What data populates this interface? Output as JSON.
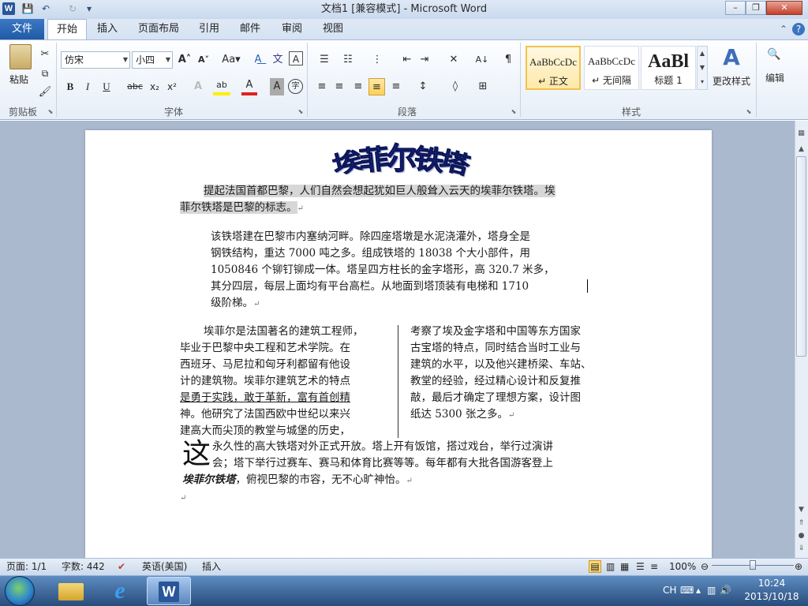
{
  "window": {
    "title": "文档1 [兼容模式] - Microsoft Word",
    "app_icon": "W",
    "minimize": "–",
    "restore": "❐",
    "close": "✕"
  },
  "qat": {
    "save_icon": "💾",
    "undo_icon": "↶",
    "redo_icon": "↻",
    "customize_icon": "▾"
  },
  "tabs": {
    "file": "文件",
    "home": "开始",
    "insert": "插入",
    "layout": "页面布局",
    "references": "引用",
    "mailings": "邮件",
    "review": "审阅",
    "view": "视图"
  },
  "ribbon": {
    "clipboard": {
      "label": "剪贴板",
      "paste": "粘贴"
    },
    "font": {
      "label": "字体",
      "font_name": "仿宋",
      "font_size": "小四",
      "grow": "A˄",
      "shrink": "A˅",
      "case": "Aa▾",
      "bold": "B",
      "italic": "I",
      "underline": "U",
      "strike": "abc",
      "sub": "x₂",
      "sup": "x²",
      "text_effect": "A",
      "highlight": "ab",
      "font_color": "A",
      "char_shade": "A",
      "enclose": "字"
    },
    "paragraph": {
      "label": "段落",
      "bullets": "☰",
      "numbering": "☷",
      "multilevel": "⋮",
      "decrease_indent": "⇤",
      "increase_indent": "⇥",
      "chinese_layout": "✕",
      "sort": "A↓",
      "show_marks": "¶",
      "align_left": "≡",
      "center": "≡",
      "align_right": "≡",
      "justify": "≡",
      "distributed": "≡",
      "line_spacing": "↕",
      "shading": "◊",
      "borders": "⊞"
    },
    "styles": {
      "label": "样式",
      "items": [
        {
          "preview": "AaBbCcDc",
          "name": "↵ 正文"
        },
        {
          "preview": "AaBbCcDc",
          "name": "↵ 无间隔"
        },
        {
          "preview": "AaBl",
          "name": "标题 1"
        }
      ],
      "change": "更改样式"
    },
    "editing": {
      "label": "编辑"
    }
  },
  "document": {
    "wordart": [
      "埃",
      "菲",
      "尔",
      "铁",
      "塔"
    ],
    "para1_line1": "提起法国首都巴黎，人们自然会想起犹如巨人般耸入云天的埃菲尔铁塔。埃",
    "para1_line2": "菲尔铁塔是巴黎的标志。",
    "para2_lines": [
      "该铁塔建在巴黎市内塞纳河畔。除四座塔墩是水泥浇灌外，塔身全是",
      "钢铁结构，重达 7000 吨之多。组成铁塔的 18038 个大小部件，用",
      "1050846 个铆钉铆成一体。塔呈四方柱长的金字塔形，高 320.7 米多，",
      "其分四层，每层上面均有平台高栏。从地面到塔顶装有电梯和 1710",
      "级阶梯。"
    ],
    "col1_lines": [
      "埃菲尔是法国著名的建筑工程师，",
      "毕业于巴黎中央工程和艺术学院。在",
      "西班牙、马尼拉和匈牙利都留有他设",
      "计的建筑物。埃菲尔建筑艺术的特点",
      "是勇于实践，敢于革新，富有首创精",
      "神。他研究了法国西欧中世纪以来兴",
      "建高大而尖顶的教堂与城堡的历史，"
    ],
    "col2_lines": [
      "考察了埃及金字塔和中国等东方国家",
      "古宝塔的特点，同时结合当时工业与",
      "建筑的水平，以及他兴建桥梁、车站、",
      "教堂的经验，经过精心设计和反复推",
      "敲，最后才确定了理想方案，设计图",
      "纸达 5300 张之多。"
    ],
    "dropcap": "这",
    "last_line1": "永久性的高大铁塔对外正式开放。塔上开有饭馆，搭过戏台，举行过演讲",
    "last_line2": "会；塔下举行过赛车、赛马和体育比赛等等。每年都有大批各国游客登上",
    "last_line3_bold": "埃菲尔铁塔",
    "last_line3_rest": "，俯视巴黎的市容，无不心旷神怡。",
    "para_mark": "↵"
  },
  "statusbar": {
    "page": "页面: 1/1",
    "words": "字数: 442",
    "language": "英语(美国)",
    "insert": "插入",
    "zoom": "100%"
  },
  "taskbar": {
    "time": "10:24",
    "date": "2013/10/18",
    "ime": "CH"
  }
}
